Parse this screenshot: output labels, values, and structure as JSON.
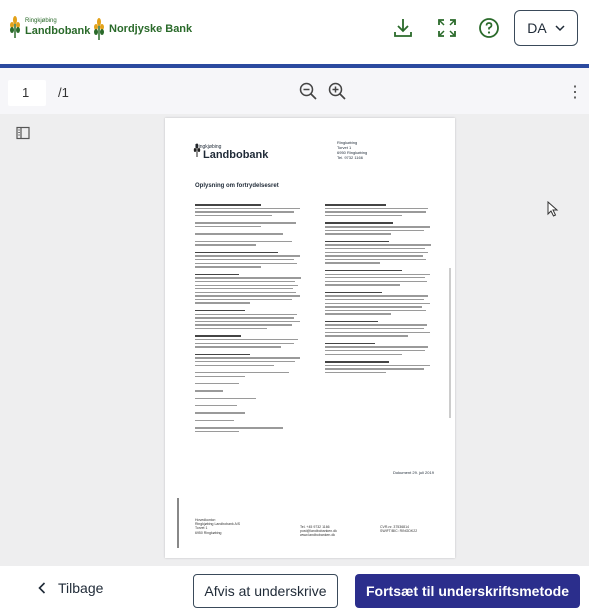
{
  "header": {
    "logo1_small": "Ringkjøbing",
    "logo1_big": "Landbobank",
    "logo2_text": "Nordjyske Bank",
    "language": "DA"
  },
  "toolbar": {
    "page_current": "1",
    "page_total": "/1"
  },
  "document": {
    "logo_small": "Ringkjøbing",
    "logo_big": "Landbobank",
    "address": "Ringkøbing\nTorvet 1\n6950 Ringkøbing\nTel. 9732 1166",
    "title": "Oplysning om fortrydelsesret",
    "date": "Dokument 29. juli 2019",
    "footer_left": "Hovedkontor:\nRingkjøbing Landbobank A/S\nTorvet 1\n6950 Ringkøbing",
    "footer_mid": "Tel. +45 9732 1166\npost@landbobanken.dk\nwww.landbobanken.dk",
    "footer_right": "CVR-nr. 37536814\nSWIFT/BIC: RINGDK22"
  },
  "footer": {
    "back_label": "Tilbage",
    "decline_label": "Afvis at underskrive",
    "continue_label": "Fortsæt til underskriftsmetode"
  },
  "colors": {
    "brand_green": "#2a6a2a",
    "primary_button": "#2b2e8c",
    "toolbar_accent": "#2b4a9f"
  }
}
